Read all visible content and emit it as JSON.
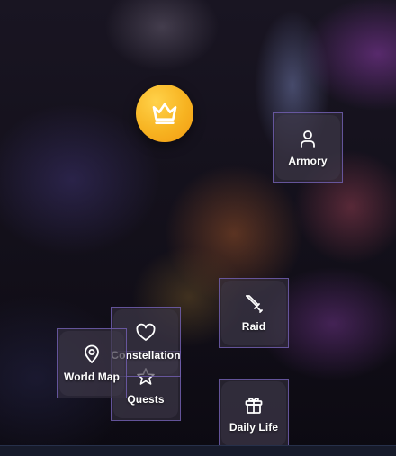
{
  "colors": {
    "crown_accent": "#f7b321",
    "tile_border": "#7864be",
    "tile_bg": "#37324a"
  },
  "crown_button": {
    "icon": "crown-icon"
  },
  "menu": {
    "armory": {
      "label": "Armory",
      "icon": "user-icon"
    },
    "raid": {
      "label": "Raid",
      "icon": "sword-icon"
    },
    "constellation": {
      "label": "Constellation",
      "icon": "heart-icon"
    },
    "world_map": {
      "label": "World Map",
      "icon": "map-pin-icon"
    },
    "quests": {
      "label": "Quests",
      "icon": "star-icon"
    },
    "daily_life": {
      "label": "Daily Life",
      "icon": "gift-icon"
    }
  }
}
